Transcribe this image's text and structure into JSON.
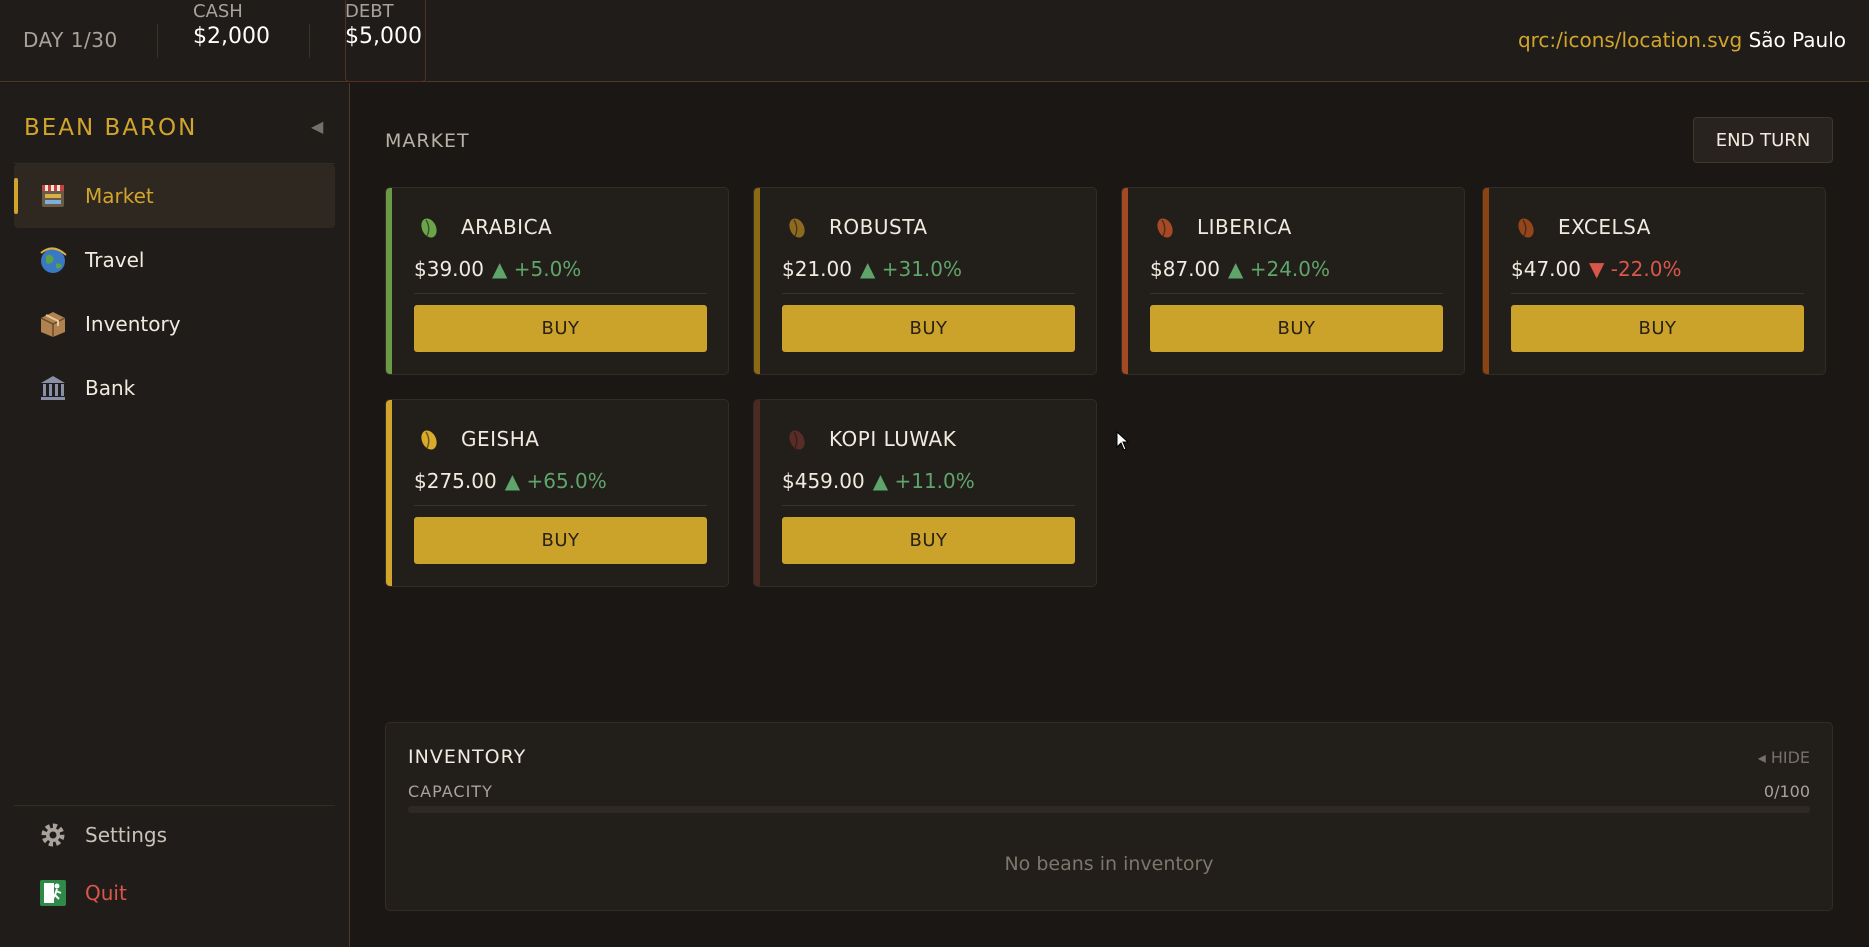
{
  "topbar": {
    "day": "DAY 1/30",
    "cash_label": "CASH",
    "cash_value": "$2,000",
    "debt_label": "DEBT",
    "debt_value": "$5,000",
    "location_icon_text": "qrc:/icons/location.svg",
    "location_city": "São Paulo"
  },
  "sidebar": {
    "brand": "BEAN BARON",
    "collapse_glyph": "◀",
    "items": [
      {
        "label": "Market",
        "icon": "market-icon"
      },
      {
        "label": "Travel",
        "icon": "globe-icon"
      },
      {
        "label": "Inventory",
        "icon": "box-icon"
      },
      {
        "label": "Bank",
        "icon": "bank-icon"
      }
    ],
    "settings_label": "Settings",
    "quit_label": "Quit"
  },
  "main": {
    "title": "MARKET",
    "end_turn_label": "END TURN",
    "beans": [
      {
        "name": "ARABICA",
        "price": "$39.00",
        "change": "▲ +5.0%",
        "direction": "up",
        "accent": "#6a9a45",
        "bean_color": "#6aa54a"
      },
      {
        "name": "ROBUSTA",
        "price": "$21.00",
        "change": "▲ +31.0%",
        "direction": "up",
        "accent": "#8a6a14",
        "bean_color": "#8d6a20"
      },
      {
        "name": "LIBERICA",
        "price": "$87.00",
        "change": "▲ +24.0%",
        "direction": "up",
        "accent": "#a24a22",
        "bean_color": "#a54a24"
      },
      {
        "name": "EXCELSA",
        "price": "$47.00",
        "change": "▼ -22.0%",
        "direction": "down",
        "accent": "#8c4312",
        "bean_color": "#94461a"
      },
      {
        "name": "GEISHA",
        "price": "$275.00",
        "change": "▲ +65.0%",
        "direction": "up",
        "accent": "#d1a52c",
        "bean_color": "#d8ab2a"
      },
      {
        "name": "KOPI LUWAK",
        "price": "$459.00",
        "change": "▲ +11.0%",
        "direction": "up",
        "accent": "#4c2a24",
        "bean_color": "#5a2c26"
      }
    ],
    "buy_label": "BUY"
  },
  "inventory": {
    "title": "INVENTORY",
    "hide_label": "◂ HIDE",
    "capacity_label": "CAPACITY",
    "capacity_value": "0/100",
    "capacity_fraction": 0,
    "empty_text": "No beans in inventory"
  }
}
